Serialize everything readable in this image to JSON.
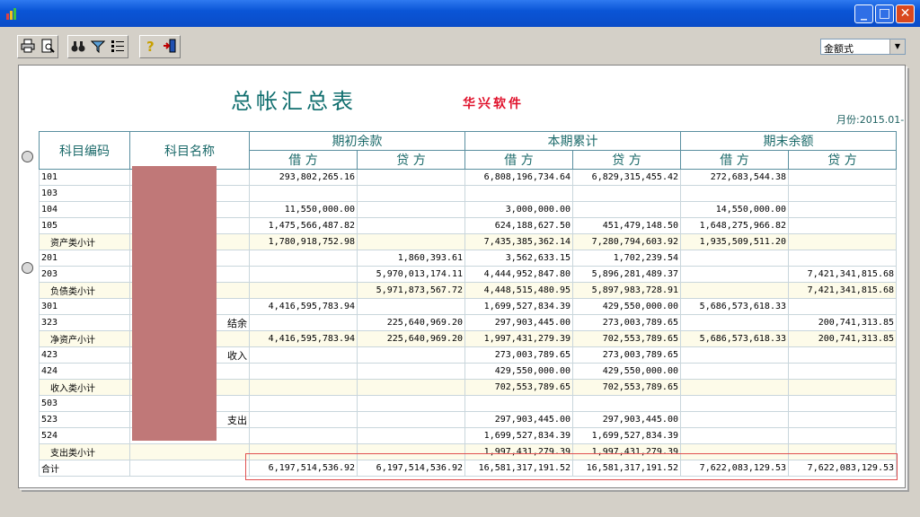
{
  "toolbar": {
    "combo_value": "金额式"
  },
  "report": {
    "title": "总帐汇总表",
    "brand": "华兴软件",
    "period": "月份:2015.01-"
  },
  "table": {
    "headers": {
      "code": "科目编码",
      "name": "科目名称",
      "opening": "期初余款",
      "current": "本期累计",
      "closing": "期末余额",
      "debit": "借 方",
      "credit": "贷 方"
    },
    "rows": [
      {
        "code": "101",
        "name": "",
        "v": [
          "293,802,265.16",
          "",
          "6,808,196,734.64",
          "6,829,315,455.42",
          "272,683,544.38",
          ""
        ]
      },
      {
        "code": "103",
        "name": "",
        "v": [
          "",
          "",
          "",
          "",
          "",
          ""
        ]
      },
      {
        "code": "104",
        "name": "",
        "v": [
          "11,550,000.00",
          "",
          "3,000,000.00",
          "",
          "14,550,000.00",
          ""
        ]
      },
      {
        "code": "105",
        "name": "",
        "v": [
          "1,475,566,487.82",
          "",
          "624,188,627.50",
          "451,479,148.50",
          "1,648,275,966.82",
          ""
        ]
      },
      {
        "code": "资产类小计",
        "name": "",
        "v": [
          "1,780,918,752.98",
          "",
          "7,435,385,362.14",
          "7,280,794,603.92",
          "1,935,509,511.20",
          ""
        ],
        "sub": true
      },
      {
        "code": "201",
        "name": "",
        "v": [
          "",
          "1,860,393.61",
          "3,562,633.15",
          "1,702,239.54",
          "",
          ""
        ]
      },
      {
        "code": "203",
        "name": "",
        "v": [
          "",
          "5,970,013,174.11",
          "4,444,952,847.80",
          "5,896,281,489.37",
          "",
          "7,421,341,815.68"
        ]
      },
      {
        "code": "负债类小计",
        "name": "",
        "v": [
          "",
          "5,971,873,567.72",
          "4,448,515,480.95",
          "5,897,983,728.91",
          "",
          "7,421,341,815.68"
        ],
        "sub": true
      },
      {
        "code": "301",
        "name": "",
        "v": [
          "4,416,595,783.94",
          "",
          "1,699,527,834.39",
          "429,550,000.00",
          "5,686,573,618.33",
          ""
        ]
      },
      {
        "code": "323",
        "name": "结余",
        "v": [
          "",
          "225,640,969.20",
          "297,903,445.00",
          "273,003,789.65",
          "",
          "200,741,313.85"
        ]
      },
      {
        "code": "净资产小计",
        "name": "",
        "v": [
          "4,416,595,783.94",
          "225,640,969.20",
          "1,997,431,279.39",
          "702,553,789.65",
          "5,686,573,618.33",
          "200,741,313.85"
        ],
        "sub": true
      },
      {
        "code": "423",
        "name": "收入",
        "v": [
          "",
          "",
          "273,003,789.65",
          "273,003,789.65",
          "",
          ""
        ]
      },
      {
        "code": "424",
        "name": "",
        "v": [
          "",
          "",
          "429,550,000.00",
          "429,550,000.00",
          "",
          ""
        ]
      },
      {
        "code": "收入类小计",
        "name": "",
        "v": [
          "",
          "",
          "702,553,789.65",
          "702,553,789.65",
          "",
          ""
        ],
        "sub": true
      },
      {
        "code": "503",
        "name": "",
        "v": [
          "",
          "",
          "",
          "",
          "",
          ""
        ]
      },
      {
        "code": "523",
        "name": "支出",
        "v": [
          "",
          "",
          "297,903,445.00",
          "297,903,445.00",
          "",
          ""
        ]
      },
      {
        "code": "524",
        "name": "",
        "v": [
          "",
          "",
          "1,699,527,834.39",
          "1,699,527,834.39",
          "",
          ""
        ]
      },
      {
        "code": "支出类小计",
        "name": "",
        "v": [
          "",
          "",
          "1,997,431,279.39",
          "1,997,431,279.39",
          "",
          ""
        ],
        "sub": true
      },
      {
        "code": "合计",
        "name": "",
        "v": [
          "6,197,514,536.92",
          "6,197,514,536.92",
          "16,581,317,191.52",
          "16,581,317,191.52",
          "7,622,083,129.53",
          "7,622,083,129.53"
        ]
      }
    ]
  }
}
